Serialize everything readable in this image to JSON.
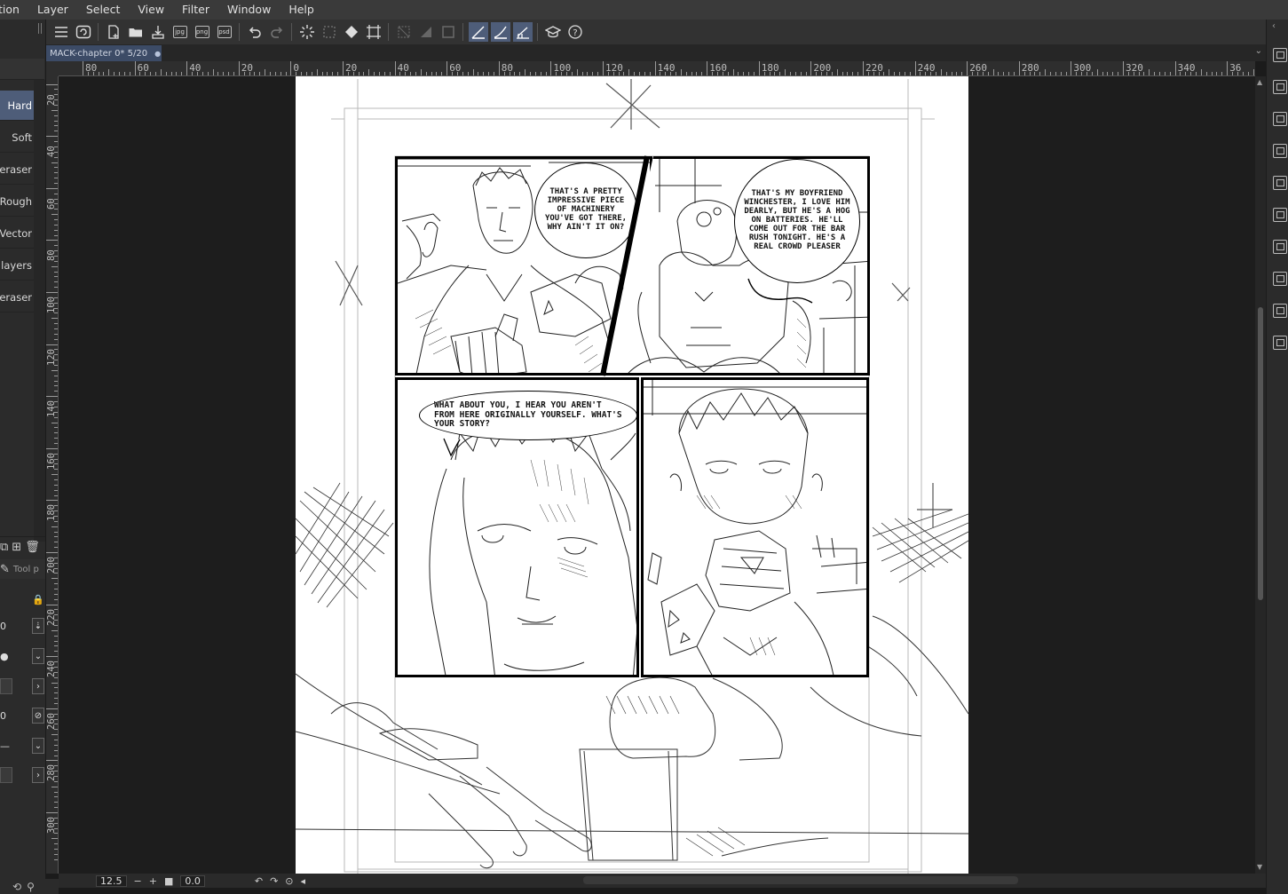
{
  "menu": {
    "items": [
      "tion",
      "Layer",
      "Select",
      "View",
      "Filter",
      "Window",
      "Help"
    ]
  },
  "toolbar": {
    "icons": [
      "menu-icon",
      "clip-studio-icon",
      "new-file-icon",
      "open-file-icon",
      "save-icon",
      "export-jpg-icon",
      "export-png-icon",
      "export-psd-icon",
      "undo-icon",
      "redo-icon",
      "sparkle-icon",
      "selection-icon",
      "fill-icon",
      "transform-icon",
      "hide-selection-icon",
      "clear-icon",
      "border-icon",
      "snap-ruler-icon",
      "snap-special-ruler-icon",
      "snap-grid-icon",
      "learn-icon",
      "help-icon"
    ],
    "labels": {
      "jpg": "jpg",
      "png": "png",
      "psd": "psd"
    }
  },
  "subtool": {
    "items": [
      "Hard",
      "Soft",
      "d eraser",
      "Rough",
      "Vector",
      "e layers",
      "p eraser"
    ],
    "selected_index": 0,
    "tool_property_label": "Tool p",
    "row1_value": "0",
    "row3_value": "0"
  },
  "tab": {
    "title": "MACK-chapter 0* 5/20",
    "modified_marker": "●"
  },
  "rulers": {
    "h_labels": [
      "80",
      "60",
      "40",
      "20",
      "0",
      "20",
      "40",
      "60",
      "80",
      "100",
      "120",
      "140",
      "160",
      "180",
      "200",
      "220",
      "240",
      "260",
      "280",
      "300",
      "320",
      "340",
      "36"
    ],
    "v_labels": [
      "20",
      "40",
      "60",
      "80",
      "100",
      "120",
      "140",
      "160",
      "180",
      "200",
      "220",
      "240",
      "260",
      "280",
      "300"
    ]
  },
  "comic": {
    "bubble1": "That's a pretty impressive piece of machinery you've got there, why ain't it on?",
    "bubble2": "That's my boyfriend Winchester, I love him dearly, but he's a hog on batteries. He'll come out for the bar rush tonight. He's a real crowd pleaser",
    "bubble3": "What about you, I hear you aren't from here originally yourself. What's your story?"
  },
  "status": {
    "zoom": "12.5",
    "rotation": "0.0"
  },
  "colors": {
    "accent": "#4e5d79",
    "tab": "#3c4b66",
    "panel_bg": "#2b2b2b",
    "canvas_bg": "#1d1d1d"
  }
}
